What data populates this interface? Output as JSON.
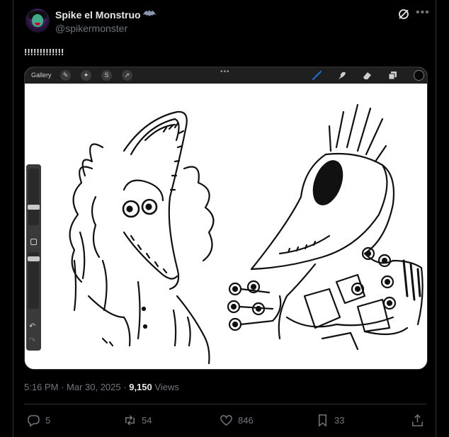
{
  "author": {
    "display_name": "Spike el Monstruo",
    "handle": "@spikermonster",
    "name_emoji_icon": "bat-icon"
  },
  "header_icons": [
    "grok-icon",
    "more-icon"
  ],
  "tweet": {
    "text": "!!!!!!!!!!!!!"
  },
  "media": {
    "app_toolbar": {
      "gallery_label": "Gallery",
      "left_tools": [
        "wrench-icon",
        "magic-wand-icon",
        "selection-icon",
        "transform-arrow-icon"
      ],
      "more_glyph": "•••",
      "right_tools": [
        "brush-icon",
        "smudge-icon",
        "eraser-icon",
        "layers-icon",
        "color-icon"
      ],
      "accent_color": "#1d6fe0"
    },
    "side_buttons": {
      "undo_glyph": "↶",
      "redo_glyph": "↷"
    }
  },
  "meta": {
    "time": "5:16 PM",
    "separator": "·",
    "date": "Mar 30, 2025",
    "separator2": "·",
    "views_count": "9,150",
    "views_label": "Views"
  },
  "actions": {
    "replies": "5",
    "reposts": "54",
    "likes": "846",
    "bookmarks": "33"
  }
}
